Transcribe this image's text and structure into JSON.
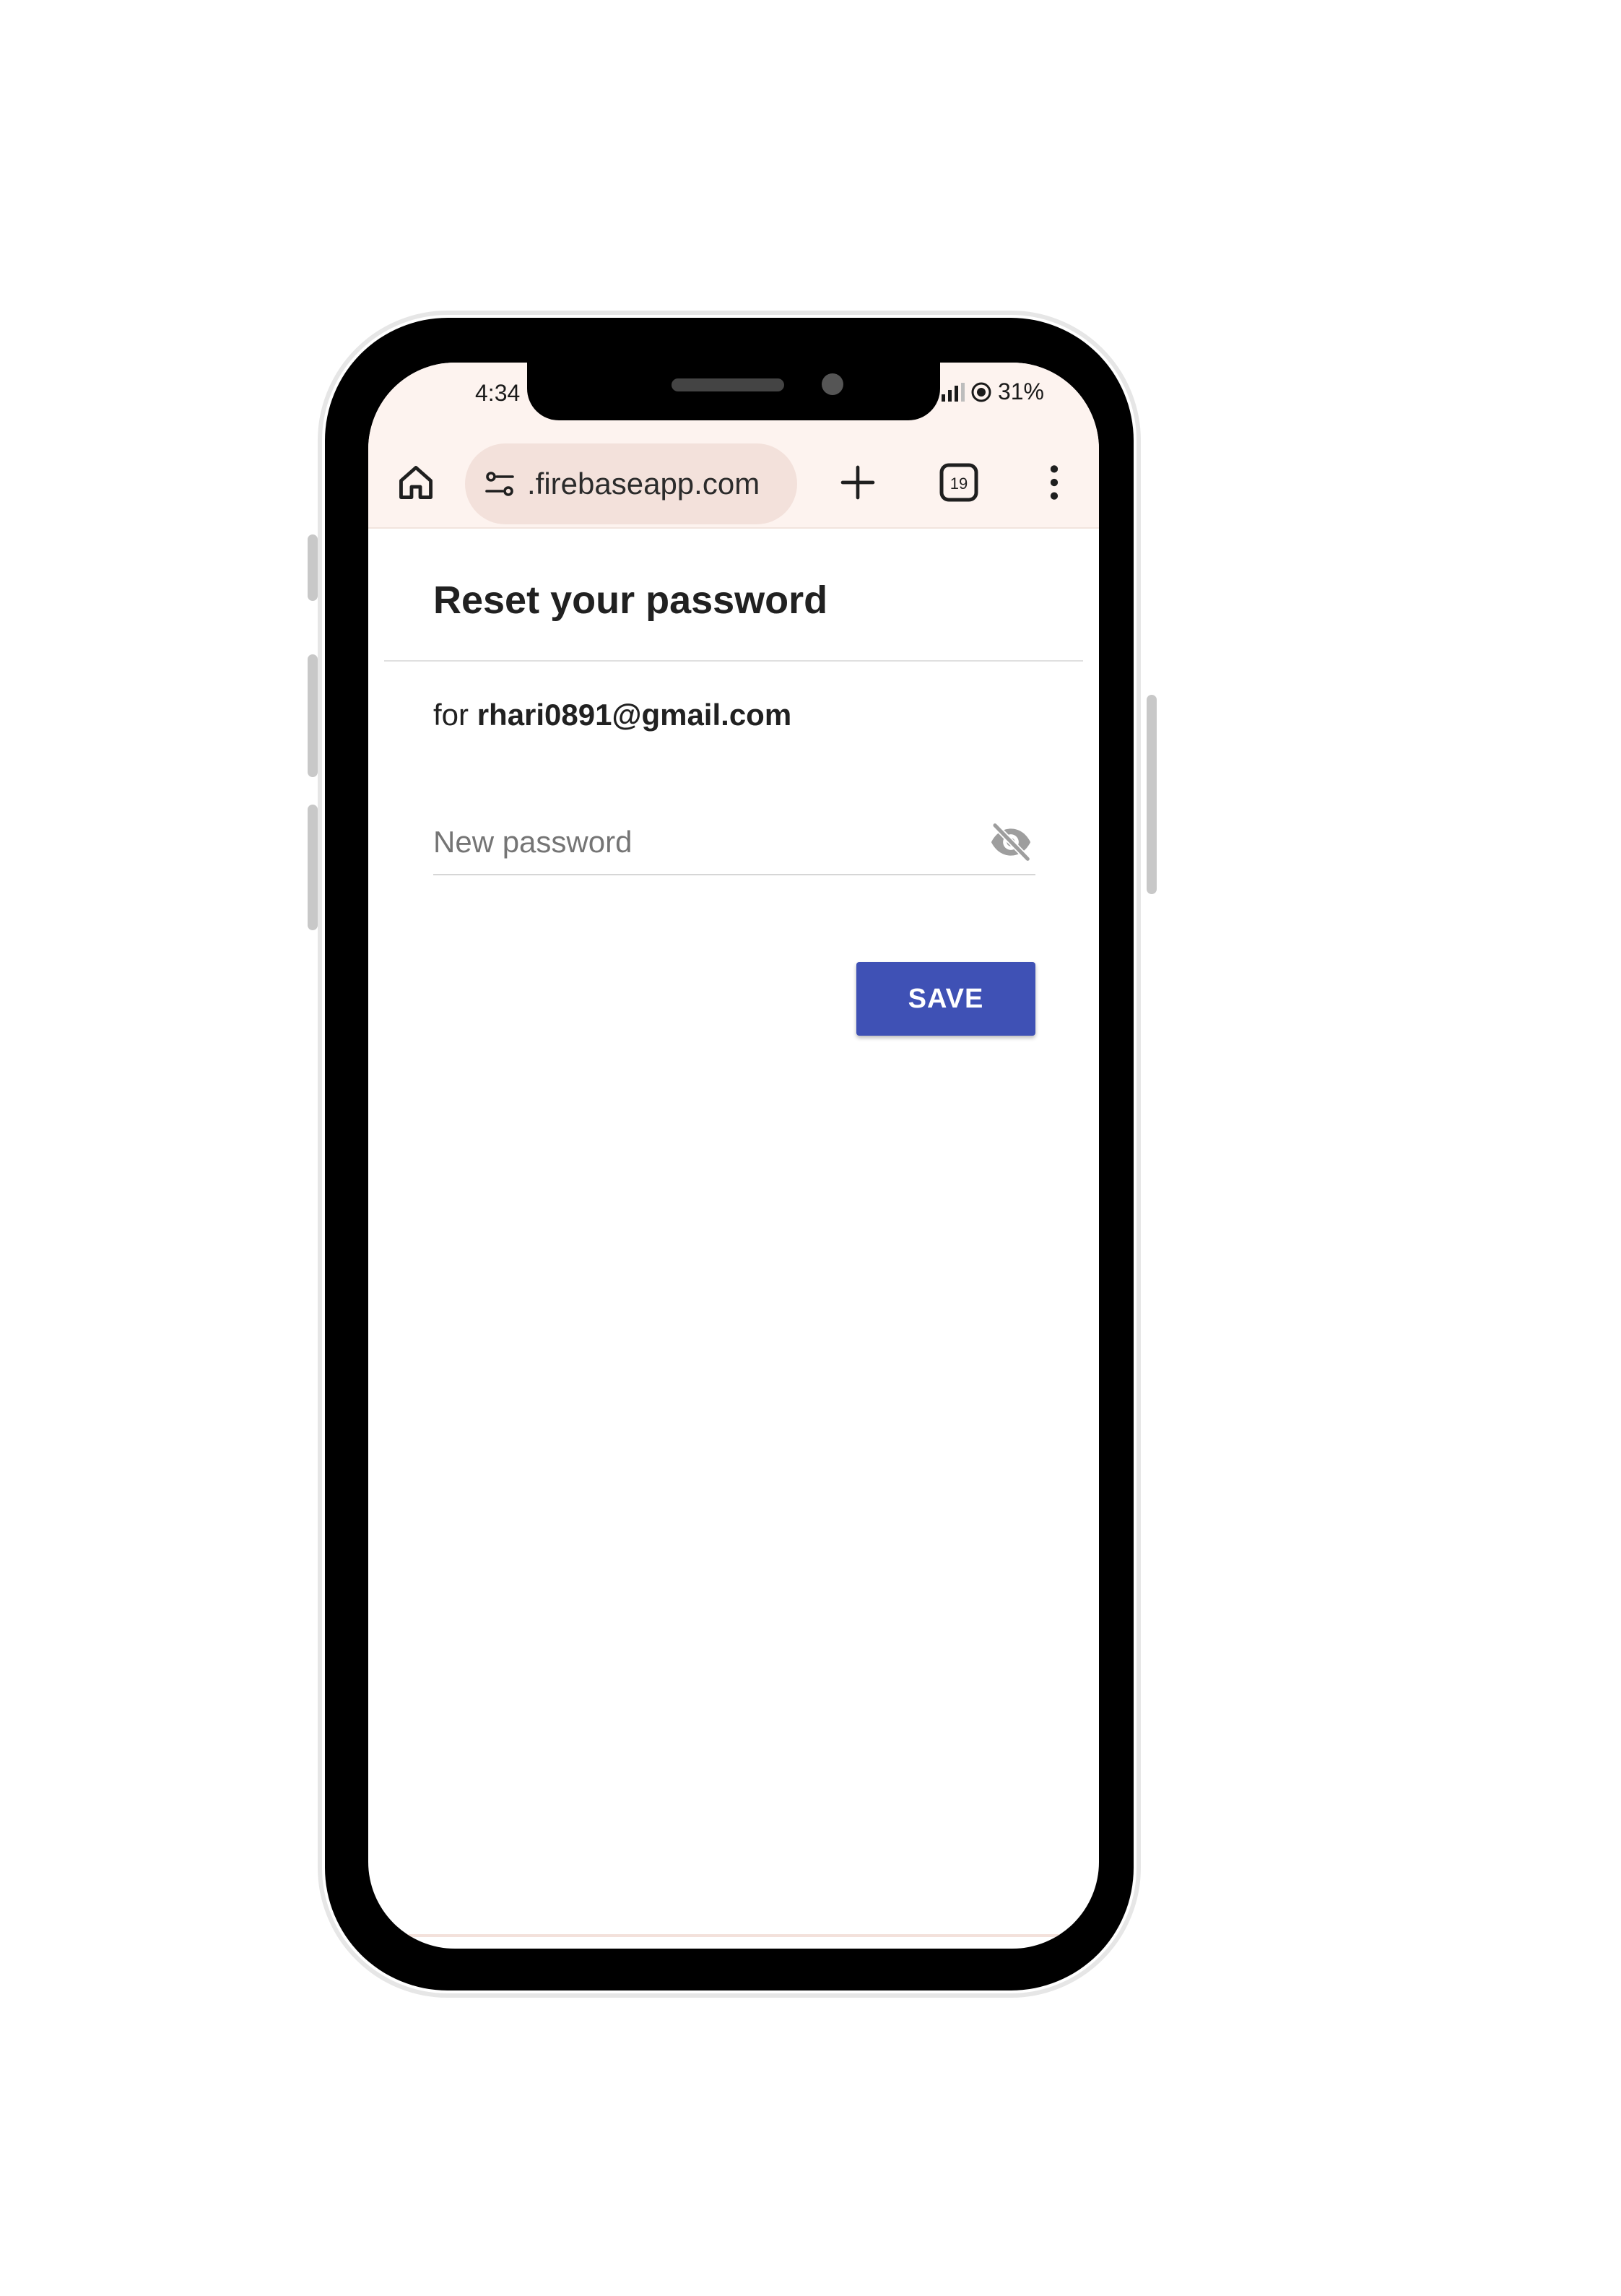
{
  "status_bar": {
    "time": "4:34",
    "battery": "31%"
  },
  "browser": {
    "url": ".firebaseapp.com",
    "tab_count": "19",
    "icons": [
      "home-icon",
      "site-settings-icon",
      "new-tab-icon",
      "tab-switcher-icon",
      "more-menu-icon"
    ]
  },
  "page": {
    "title": "Reset your password",
    "for_prefix": "for",
    "email": "rhari0891@gmail.com",
    "password_placeholder": "New password",
    "password_value": "",
    "save_label": "SAVE"
  },
  "colors": {
    "accent": "#3f51b5",
    "toolbar_bg": "#fdf3ef",
    "urlbar_bg": "#f3e1db"
  }
}
